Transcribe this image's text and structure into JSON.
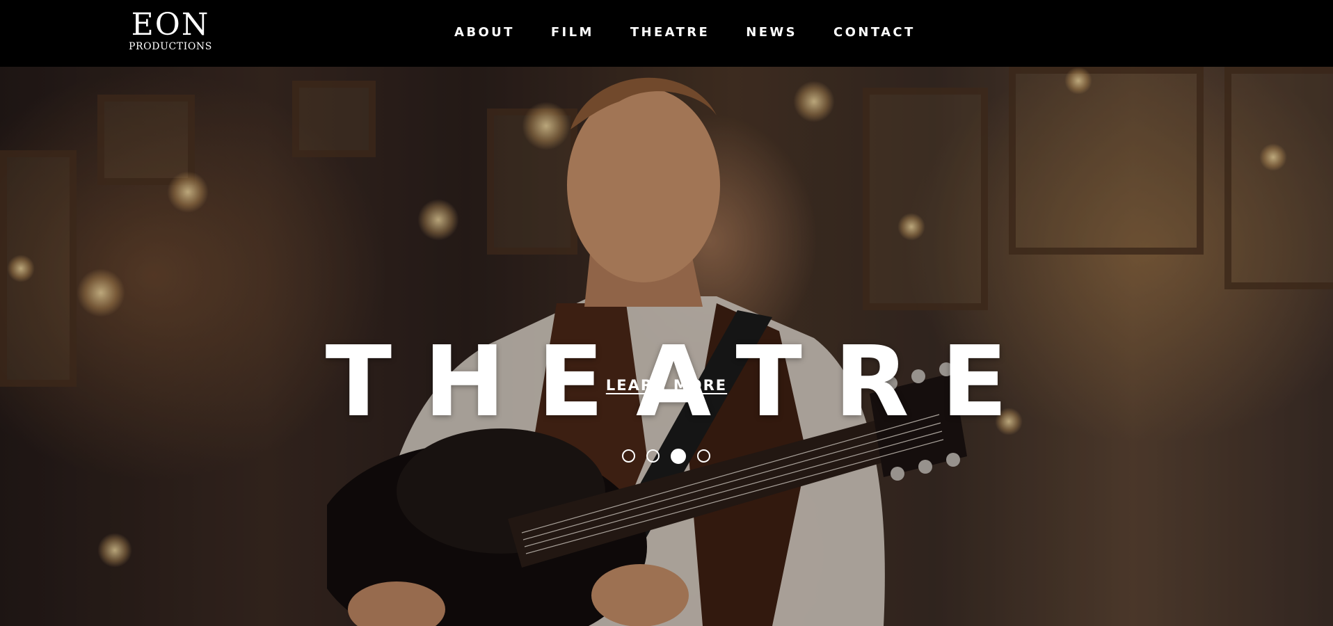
{
  "brand": {
    "name": "EON",
    "subtitle": "PRODUCTIONS"
  },
  "nav": {
    "items": [
      {
        "label": "ABOUT"
      },
      {
        "label": "FILM"
      },
      {
        "label": "THEATRE"
      },
      {
        "label": "NEWS"
      },
      {
        "label": "CONTACT"
      }
    ]
  },
  "hero": {
    "title": "THEATRE",
    "cta_label": "LEARN MORE",
    "slides_total": 4,
    "active_slide": 3
  },
  "colors": {
    "header_background": "#000000",
    "text": "#ffffff"
  }
}
